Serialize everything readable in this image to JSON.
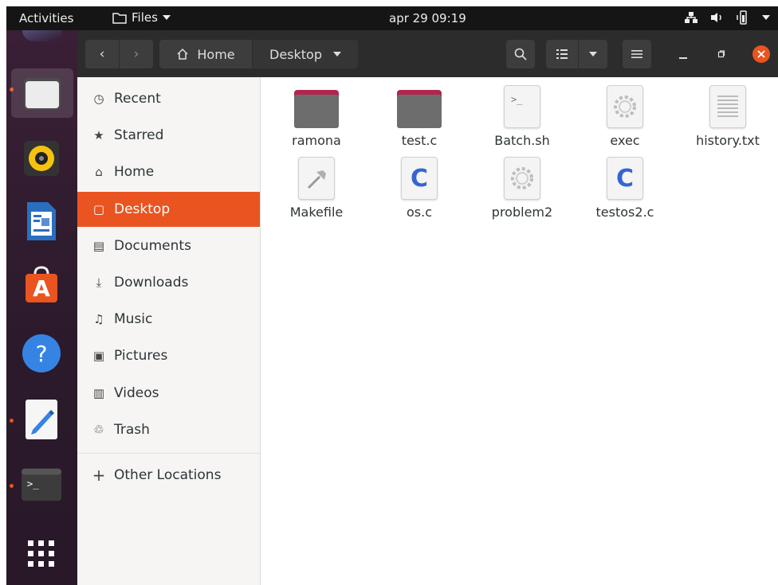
{
  "topbar": {
    "activities": "Activities",
    "app_name": "Files",
    "clock": "apr 29  09:19"
  },
  "headerbar": {
    "home_label": "Home",
    "current_folder": "Desktop"
  },
  "sidebar": {
    "items": [
      {
        "label": "Recent",
        "icon": "clock-icon"
      },
      {
        "label": "Starred",
        "icon": "star-icon"
      },
      {
        "label": "Home",
        "icon": "home-icon"
      },
      {
        "label": "Desktop",
        "icon": "desktop-icon",
        "selected": true
      },
      {
        "label": "Documents",
        "icon": "document-icon"
      },
      {
        "label": "Downloads",
        "icon": "download-icon"
      },
      {
        "label": "Music",
        "icon": "music-icon"
      },
      {
        "label": "Pictures",
        "icon": "picture-icon"
      },
      {
        "label": "Videos",
        "icon": "video-icon"
      },
      {
        "label": "Trash",
        "icon": "trash-icon"
      }
    ],
    "other_locations": "Other Locations"
  },
  "files": [
    {
      "name": "ramona",
      "kind": "folder"
    },
    {
      "name": "test.c",
      "kind": "folder"
    },
    {
      "name": "Batch.sh",
      "kind": "script"
    },
    {
      "name": "exec",
      "kind": "executable"
    },
    {
      "name": "history.txt",
      "kind": "text"
    },
    {
      "name": "Makefile",
      "kind": "makefile"
    },
    {
      "name": "os.c",
      "kind": "c-source"
    },
    {
      "name": "problem2",
      "kind": "executable"
    },
    {
      "name": "testos2.c",
      "kind": "c-source"
    }
  ],
  "colors": {
    "accent": "#e95420",
    "folder_tab": "#b0264f",
    "c_letter": "#3465d4"
  }
}
